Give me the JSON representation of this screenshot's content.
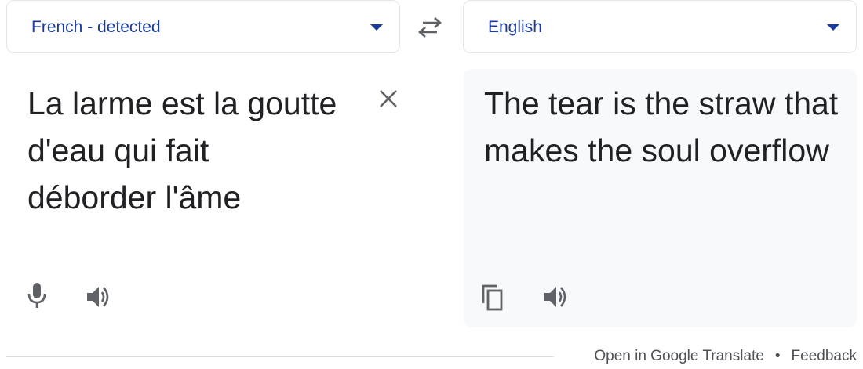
{
  "source": {
    "language_label": "French - detected",
    "text": "La larme est la goutte d'eau qui fait déborder l'âme"
  },
  "target": {
    "language_label": "English",
    "text": "The tear is the straw that makes the soul overflow"
  },
  "footer": {
    "open_link": "Open in Google Translate",
    "separator": "•",
    "feedback_link": "Feedback"
  },
  "colors": {
    "language_label": "#1a3a9c",
    "text": "#202124",
    "icon": "#5f6368",
    "target_panel": "#f8f9fa"
  },
  "icons": {
    "swap": "swap-arrows-icon",
    "clear": "close-icon",
    "mic": "microphone-icon",
    "speaker": "speaker-icon",
    "copy": "copy-icon",
    "dropdown": "caret-down-icon"
  }
}
